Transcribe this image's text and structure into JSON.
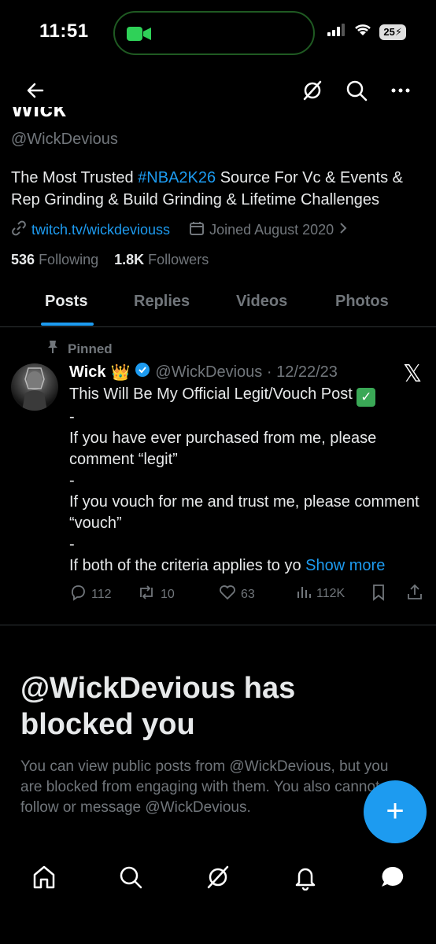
{
  "status_bar": {
    "time": "11:51",
    "battery": "25"
  },
  "profile": {
    "name": "Wick",
    "handle": "@WickDevious",
    "bio_before": "The Most Trusted ",
    "bio_hashtag": "#NBA2K26",
    "bio_after": " Source For Vc & Events & Rep Grinding & Build Grinding & Lifetime Challenges",
    "link": "twitch.tv/wickdeviouss",
    "joined": "Joined August 2020",
    "following_count": "536",
    "following_label": "Following",
    "followers_count": "1.8K",
    "followers_label": "Followers"
  },
  "tabs": [
    {
      "label": "Posts"
    },
    {
      "label": "Replies"
    },
    {
      "label": "Videos"
    },
    {
      "label": "Photos"
    }
  ],
  "post": {
    "pinned_label": "Pinned",
    "author": "Wick",
    "handle_date": "@WickDevious · 12/22/23",
    "body_line1": "This Will Be My Official Legit/Vouch Post",
    "body_rest": "-\nIf you have ever purchased from me, please comment “legit”\n-\nIf you vouch for me and trust me, please comment “vouch”\n-\nIf both of the criteria applies to yo ",
    "show_more": "Show more",
    "replies": "112",
    "reposts": "10",
    "likes": "63",
    "views": "112K"
  },
  "blocked": {
    "title": "@WickDevious has blocked you",
    "text": "You can view public posts from @WickDevious, but you are blocked from engaging with them. You also cannot follow or message @WickDevious."
  },
  "colors": {
    "accent": "#1d9bf0",
    "muted": "#71767b",
    "background": "#000000"
  },
  "icons": {
    "nav": [
      "back-arrow-icon",
      "grok-icon",
      "search-icon",
      "more-icon"
    ],
    "bottom_nav": [
      "home-icon",
      "search-icon",
      "grok-icon",
      "notifications-icon",
      "messages-icon"
    ]
  }
}
